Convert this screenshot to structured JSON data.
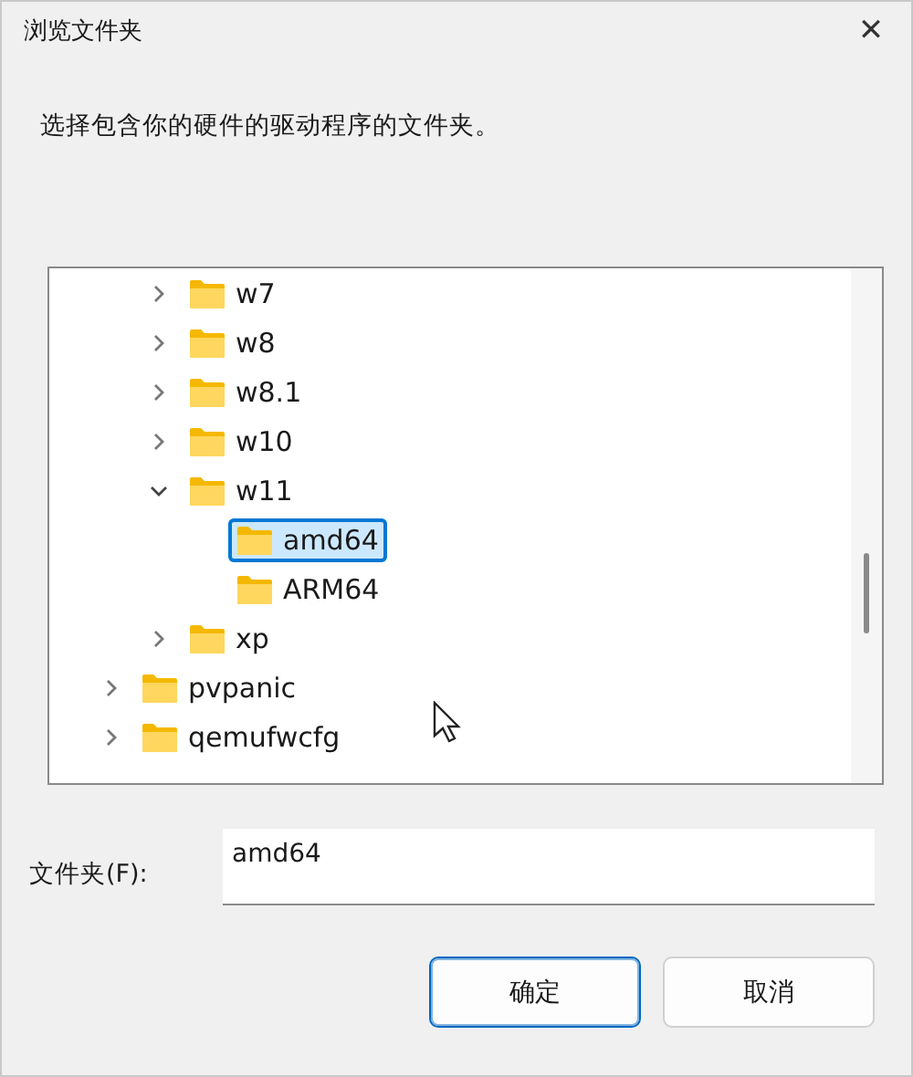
{
  "window": {
    "title": "浏览文件夹",
    "close": "✕"
  },
  "instruction": "选择包含你的硬件的驱动程序的文件夹。",
  "tree": {
    "items": [
      {
        "children": [
          {
            "label": "w7",
            "expanded": false,
            "selected": false
          },
          {
            "label": "w8",
            "expanded": false,
            "selected": false
          },
          {
            "label": "w8.1",
            "expanded": false,
            "selected": false
          },
          {
            "label": "w10",
            "expanded": false,
            "selected": false
          },
          {
            "label": "w11",
            "expanded": true,
            "selected": false,
            "children": [
              {
                "label": "amd64",
                "selected": true
              },
              {
                "label": "ARM64",
                "selected": false
              }
            ]
          },
          {
            "label": "xp",
            "expanded": false,
            "selected": false
          }
        ]
      },
      {
        "label": "pvpanic",
        "expanded": false,
        "selected": false
      },
      {
        "label": "qemufwcfg",
        "expanded": false,
        "selected": false
      }
    ]
  },
  "folder_field": {
    "label": "文件夹(F):",
    "value": "amd64"
  },
  "buttons": [
    {
      "label": "确定",
      "default": true
    },
    {
      "label": "取消",
      "default": false
    }
  ]
}
